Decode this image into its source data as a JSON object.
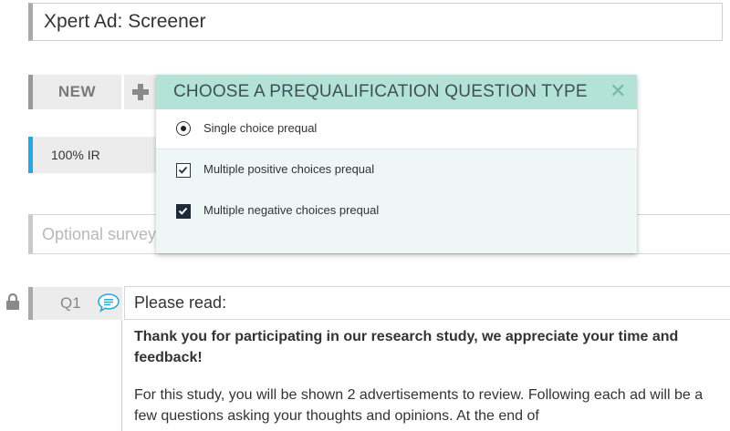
{
  "survey": {
    "title": "Xpert Ad: Screener",
    "new_label": "NEW",
    "ir_label": "100% IR",
    "optional_placeholder": "Optional survey introduction"
  },
  "modal": {
    "title": "CHOOSE A PREQUALIFICATION QUESTION TYPE",
    "close_icon": "close-icon",
    "options": [
      {
        "label": "Single choice prequal",
        "control": "radio",
        "selected": true
      },
      {
        "label": "Multiple positive choices prequal",
        "control": "checkbox-outline"
      },
      {
        "label": "Multiple negative choices prequal",
        "control": "checkbox-filled"
      }
    ]
  },
  "question": {
    "number": "Q1",
    "title": "Please read:",
    "bold_text": "Thank you for participating in our research study, we appreciate your time and feedback!",
    "body_text": "For this study,  you will be shown 2 advertisements to review.  Following each ad will be a few questions asking your thoughts and opinions.  At the end of"
  },
  "colors": {
    "accent_blue": "#29a7de",
    "modal_header": "#b3e3d6",
    "modal_body": "#eef7f5"
  }
}
